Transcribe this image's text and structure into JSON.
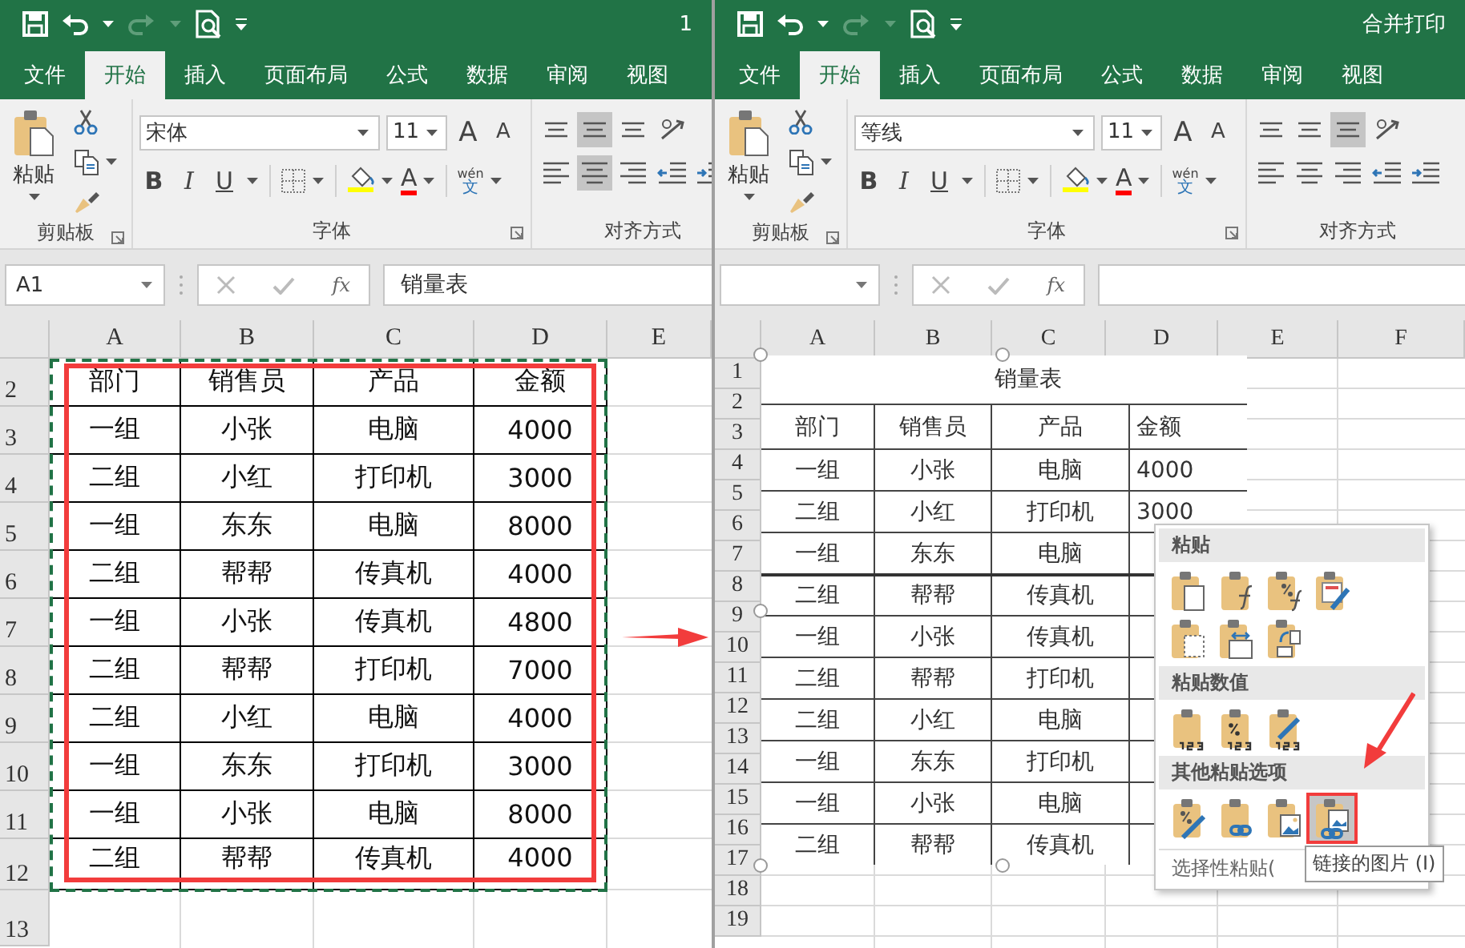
{
  "windows": [
    {
      "title": "1",
      "tabs": [
        {
          "label": "文件",
          "selected": false
        },
        {
          "label": "开始",
          "selected": true
        },
        {
          "label": "插入",
          "selected": false
        },
        {
          "label": "页面布局",
          "selected": false
        },
        {
          "label": "公式",
          "selected": false
        },
        {
          "label": "数据",
          "selected": false
        },
        {
          "label": "审阅",
          "selected": false
        },
        {
          "label": "视图",
          "selected": false
        }
      ],
      "ribbon": {
        "paste_label": "粘贴",
        "font_name": "宋体",
        "font_size": "11",
        "grow_font": "A",
        "shrink_font": "A",
        "bold": "B",
        "italic": "I",
        "underline": "U",
        "font_color": "A",
        "phonetic_top": "wén",
        "phonetic_char": "文",
        "groups": [
          "剪贴板",
          "字体",
          "对齐方式"
        ],
        "alignment": [
          {
            "kind": "top",
            "selected": false
          },
          {
            "kind": "middle",
            "selected": true
          },
          {
            "kind": "bottom",
            "selected": false
          },
          {
            "kind": "orientation",
            "selected": false
          },
          {
            "kind": "left",
            "selected": false
          },
          {
            "kind": "center",
            "selected": true
          },
          {
            "kind": "right",
            "selected": false
          },
          {
            "kind": "outdent",
            "selected": false
          },
          {
            "kind": "indent",
            "selected": false
          }
        ]
      },
      "name_box": "A1",
      "fx": "fx",
      "formula": "销量表",
      "sheet": {
        "kind": "table",
        "columns": [
          "A",
          "B",
          "C",
          "D",
          "E"
        ],
        "rows": [
          "2",
          "3",
          "4",
          "5",
          "6",
          "7",
          "8",
          "9",
          "10",
          "11",
          "12",
          "13"
        ],
        "cells": [
          [
            "部门",
            "销售员",
            "产品",
            "金额"
          ],
          [
            "一组",
            "小张",
            "电脑",
            "4000"
          ],
          [
            "二组",
            "小红",
            "打印机",
            "3000"
          ],
          [
            "一组",
            "东东",
            "电脑",
            "8000"
          ],
          [
            "二组",
            "帮帮",
            "传真机",
            "4000"
          ],
          [
            "一组",
            "小张",
            "传真机",
            "4800"
          ],
          [
            "二组",
            "帮帮",
            "打印机",
            "7000"
          ],
          [
            "二组",
            "小红",
            "电脑",
            "4000"
          ],
          [
            "一组",
            "东东",
            "打印机",
            "3000"
          ],
          [
            "一组",
            "小张",
            "电脑",
            "8000"
          ],
          [
            "二组",
            "帮帮",
            "传真机",
            "4000"
          ]
        ]
      }
    },
    {
      "title": "合并打印",
      "tabs": [
        {
          "label": "文件",
          "selected": false
        },
        {
          "label": "开始",
          "selected": true
        },
        {
          "label": "插入",
          "selected": false
        },
        {
          "label": "页面布局",
          "selected": false
        },
        {
          "label": "公式",
          "selected": false
        },
        {
          "label": "数据",
          "selected": false
        },
        {
          "label": "审阅",
          "selected": false
        },
        {
          "label": "视图",
          "selected": false
        }
      ],
      "ribbon": {
        "paste_label": "粘贴",
        "font_name": "等线",
        "font_size": "11",
        "grow_font": "A",
        "shrink_font": "A",
        "bold": "B",
        "italic": "I",
        "underline": "U",
        "font_color": "A",
        "phonetic_top": "wén",
        "phonetic_char": "文",
        "groups": [
          "剪贴板",
          "字体",
          "对齐方式"
        ],
        "alignment": [
          {
            "kind": "top",
            "selected": false
          },
          {
            "kind": "middle",
            "selected": false
          },
          {
            "kind": "bottom",
            "selected": true
          },
          {
            "kind": "orientation",
            "selected": false
          },
          {
            "kind": "left",
            "selected": false
          },
          {
            "kind": "center",
            "selected": false
          },
          {
            "kind": "right",
            "selected": false
          },
          {
            "kind": "outdent",
            "selected": false
          },
          {
            "kind": "indent",
            "selected": false
          }
        ]
      },
      "fx": "fx",
      "sheet": {
        "kind": "picture",
        "columns": [
          "A",
          "B",
          "C",
          "D",
          "E",
          "F"
        ],
        "rows": [
          "1",
          "2",
          "3",
          "4",
          "5",
          "6",
          "7",
          "8",
          "9",
          "10",
          "11",
          "12",
          "13",
          "14",
          "15",
          "16",
          "17",
          "18",
          "19"
        ],
        "picture": {
          "title": "销量表",
          "rows": [
            [
              "部门",
              "销售员",
              "产品",
              "金额"
            ],
            [
              "一组",
              "小张",
              "电脑",
              "4000"
            ],
            [
              "二组",
              "小红",
              "打印机",
              "3000"
            ],
            [
              "一组",
              "东东",
              "电脑"
            ],
            [
              "二组",
              "帮帮",
              "传真机"
            ],
            [
              "一组",
              "小张",
              "传真机"
            ],
            [
              "二组",
              "帮帮",
              "打印机"
            ],
            [
              "二组",
              "小红",
              "电脑"
            ],
            [
              "一组",
              "东东",
              "打印机"
            ],
            [
              "一组",
              "小张",
              "电脑"
            ],
            [
              "二组",
              "帮帮",
              "传真机"
            ]
          ]
        },
        "paste_menu": {
          "sections": [
            {
              "title": "粘贴",
              "options": [
                {
                  "kind": "all",
                  "selected": false
                },
                {
                  "kind": "formulas",
                  "selected": false
                },
                {
                  "kind": "formulasformat",
                  "selected": false
                },
                {
                  "kind": "sourceformat",
                  "selected": false
                },
                {
                  "kind": "noborders",
                  "selected": false
                },
                {
                  "kind": "colwidths",
                  "selected": false
                },
                {
                  "kind": "transpose",
                  "selected": false
                }
              ]
            },
            {
              "title": "粘贴数值",
              "options": [
                {
                  "kind": "values",
                  "selected": false
                },
                {
                  "kind": "valuesformat",
                  "selected": false
                },
                {
                  "kind": "valuessource",
                  "selected": false
                }
              ]
            },
            {
              "title": "其他粘贴选项",
              "options": [
                {
                  "kind": "formatting",
                  "selected": false
                },
                {
                  "kind": "link",
                  "selected": false
                },
                {
                  "kind": "picture",
                  "selected": false
                },
                {
                  "kind": "linkedpicture",
                  "selected": true
                }
              ]
            }
          ],
          "footer": "选择性粘贴(",
          "tooltip": "链接的图片 (I)"
        }
      }
    }
  ]
}
